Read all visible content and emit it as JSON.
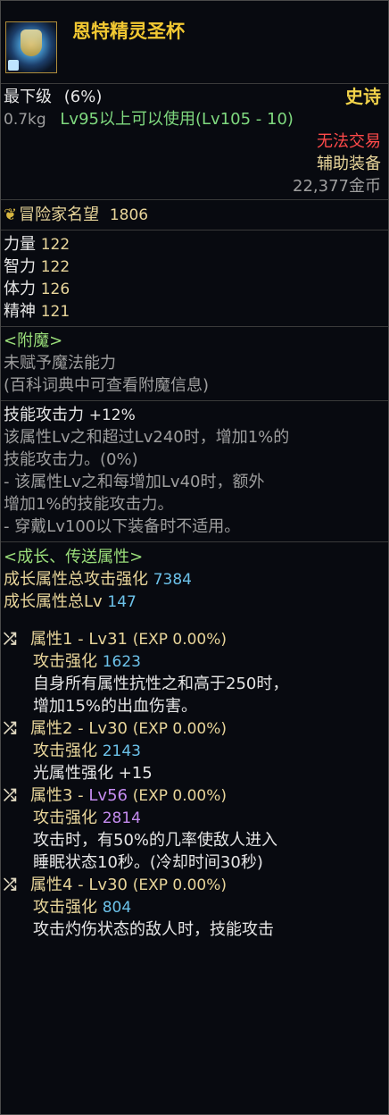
{
  "item": {
    "name": "恩特精灵圣杯",
    "grade": "最下级",
    "grade_pct": "(6%)",
    "rarity": "史诗",
    "weight": "0.7kg",
    "level_req": "Lv95以上可以使用(Lv105 - 10)",
    "trade": "无法交易",
    "type": "辅助装备",
    "price": "22,377金币"
  },
  "fame": {
    "label": "冒险家名望",
    "value": "1806"
  },
  "stats": [
    {
      "label": "力量",
      "value": "122"
    },
    {
      "label": "智力",
      "value": "122"
    },
    {
      "label": "体力",
      "value": "126"
    },
    {
      "label": "精神",
      "value": "121"
    }
  ],
  "enchant": {
    "header": "<附魔>",
    "line1": "未赋予魔法能力",
    "line2": "(百科词典中可查看附魔信息)"
  },
  "skill": {
    "label": "技能攻击力",
    "value": "+12%",
    "lines": [
      "该属性Lv之和超过Lv240时，增加1%的",
      "技能攻击力。(0%)",
      "- 该属性Lv之和每增加Lv40时，额外",
      "增加1%的技能攻击力。",
      "- 穿戴Lv100以下装备时不适用。"
    ]
  },
  "growth": {
    "header": "<成长、传送属性>",
    "total_atk_label": "成长属性总攻击强化",
    "total_atk_value": "7384",
    "total_lv_label": "成长属性总Lv",
    "total_lv_value": "147",
    "attrs": [
      {
        "prefix": "属性1 - ",
        "lv": "Lv31",
        "exp": "(EXP 0.00%)",
        "atk_label": "攻击强化",
        "atk_value": "1623",
        "desc": [
          "自身所有属性抗性之和高于250时，",
          "增加15%的出血伤害。"
        ]
      },
      {
        "prefix": "属性2 - ",
        "lv": "Lv30",
        "exp": "(EXP 0.00%)",
        "atk_label": "攻击强化",
        "atk_value": "2143",
        "desc": [
          "光属性强化 +15"
        ]
      },
      {
        "prefix": "属性3 - ",
        "lv": "Lv56",
        "exp": "(EXP 0.00%)",
        "atk_label": "攻击强化",
        "atk_value": "2814",
        "desc": [
          "攻击时，有50%的几率使敌人进入",
          "睡眠状态10秒。(冷却时间30秒)"
        ]
      },
      {
        "prefix": "属性4 - ",
        "lv": "Lv30",
        "exp": "(EXP 0.00%)",
        "atk_label": "攻击强化",
        "atk_value": "804",
        "desc": [
          "攻击灼伤状态的敌人时，技能攻击"
        ]
      }
    ]
  },
  "icons": {
    "item": "chalice-icon",
    "fame": "laurel-icon",
    "attr": "shuffle-icon"
  },
  "colors": {
    "title": "#f2c832",
    "rarity": "#f2c832",
    "trade": "#ff4a4a",
    "enchant": "#9ade7a",
    "value_blue": "#6cc2ea",
    "value_purple": "#c58cf0"
  }
}
